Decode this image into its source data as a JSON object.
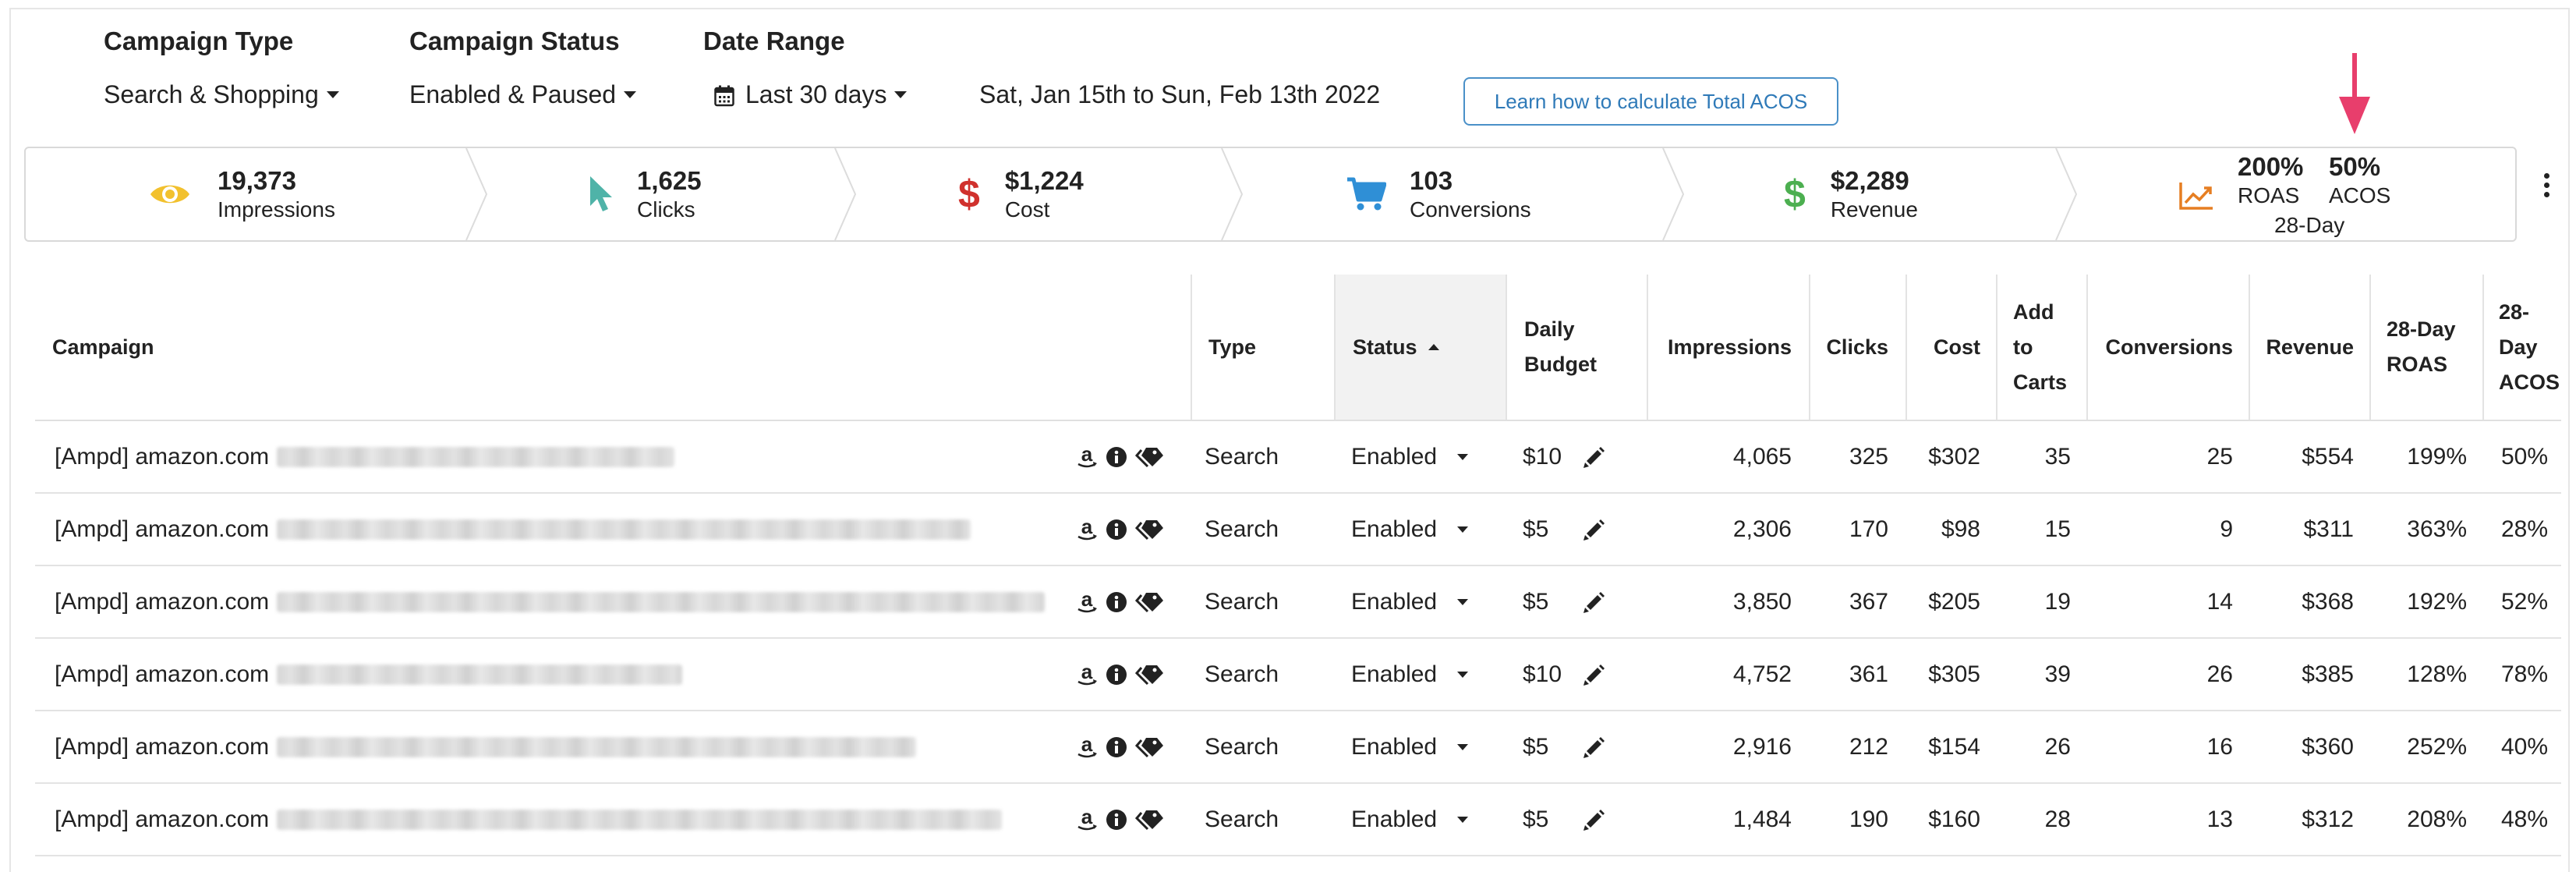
{
  "filters": {
    "campaign_type": {
      "label": "Campaign Type",
      "value": "Search & Shopping"
    },
    "campaign_status": {
      "label": "Campaign Status",
      "value": "Enabled & Paused"
    },
    "date_range": {
      "label": "Date Range",
      "value": "Last 30 days",
      "text": "Sat, Jan 15th to Sun, Feb 13th 2022"
    },
    "learn_button": "Learn how to calculate Total ACOS"
  },
  "metrics": {
    "impressions": {
      "value": "19,373",
      "label": "Impressions",
      "icon": "eye-icon",
      "color": "#f2c12e"
    },
    "clicks": {
      "value": "1,625",
      "label": "Clicks",
      "icon": "cursor-icon",
      "color": "#4fb3a8"
    },
    "cost": {
      "value": "$1,224",
      "label": "Cost",
      "icon": "dollar-icon",
      "color": "#d0312d"
    },
    "conversions": {
      "value": "103",
      "label": "Conversions",
      "icon": "cart-icon",
      "color": "#2f8fd6"
    },
    "revenue": {
      "value": "$2,289",
      "label": "Revenue",
      "icon": "dollar-icon",
      "color": "#4caf50"
    },
    "roas": {
      "value": "200%",
      "label": "ROAS"
    },
    "acos": {
      "value": "50%",
      "label": "ACOS"
    },
    "period": "28-Day",
    "trend_icon_color": "#e67e22",
    "arrow_color": "#e83e6c"
  },
  "table": {
    "headers": {
      "campaign": "Campaign",
      "type": "Type",
      "status": "Status",
      "daily_budget_1": "Daily",
      "daily_budget_2": "Budget",
      "impressions": "Impressions",
      "clicks": "Clicks",
      "cost": "Cost",
      "add_to_carts_1": "Add",
      "add_to_carts_2": "to",
      "add_to_carts_3": "Carts",
      "conversions": "Conversions",
      "revenue": "Revenue",
      "roas_1": "28-Day",
      "roas_2": "ROAS",
      "acos_1": "28-Day",
      "acos_2": "ACOS"
    },
    "rows": [
      {
        "campaign": "[Ampd] amazon.com",
        "type": "Search",
        "status": "Enabled",
        "budget": "$10",
        "impressions": "4,065",
        "clicks": "325",
        "cost": "$302",
        "add_to_carts": "35",
        "conversions": "25",
        "revenue": "$554",
        "roas": "199%",
        "acos": "50%"
      },
      {
        "campaign": "[Ampd] amazon.com",
        "type": "Search",
        "status": "Enabled",
        "budget": "$5",
        "impressions": "2,306",
        "clicks": "170",
        "cost": "$98",
        "add_to_carts": "15",
        "conversions": "9",
        "revenue": "$311",
        "roas": "363%",
        "acos": "28%"
      },
      {
        "campaign": "[Ampd] amazon.com",
        "type": "Search",
        "status": "Enabled",
        "budget": "$5",
        "impressions": "3,850",
        "clicks": "367",
        "cost": "$205",
        "add_to_carts": "19",
        "conversions": "14",
        "revenue": "$368",
        "roas": "192%",
        "acos": "52%"
      },
      {
        "campaign": "[Ampd] amazon.com",
        "type": "Search",
        "status": "Enabled",
        "budget": "$10",
        "impressions": "4,752",
        "clicks": "361",
        "cost": "$305",
        "add_to_carts": "39",
        "conversions": "26",
        "revenue": "$385",
        "roas": "128%",
        "acos": "78%"
      },
      {
        "campaign": "[Ampd] amazon.com",
        "type": "Search",
        "status": "Enabled",
        "budget": "$5",
        "impressions": "2,916",
        "clicks": "212",
        "cost": "$154",
        "add_to_carts": "26",
        "conversions": "16",
        "revenue": "$360",
        "roas": "252%",
        "acos": "40%"
      },
      {
        "campaign": "[Ampd] amazon.com",
        "type": "Search",
        "status": "Enabled",
        "budget": "$5",
        "impressions": "1,484",
        "clicks": "190",
        "cost": "$160",
        "add_to_carts": "28",
        "conversions": "13",
        "revenue": "$312",
        "roas": "208%",
        "acos": "48%"
      }
    ]
  }
}
